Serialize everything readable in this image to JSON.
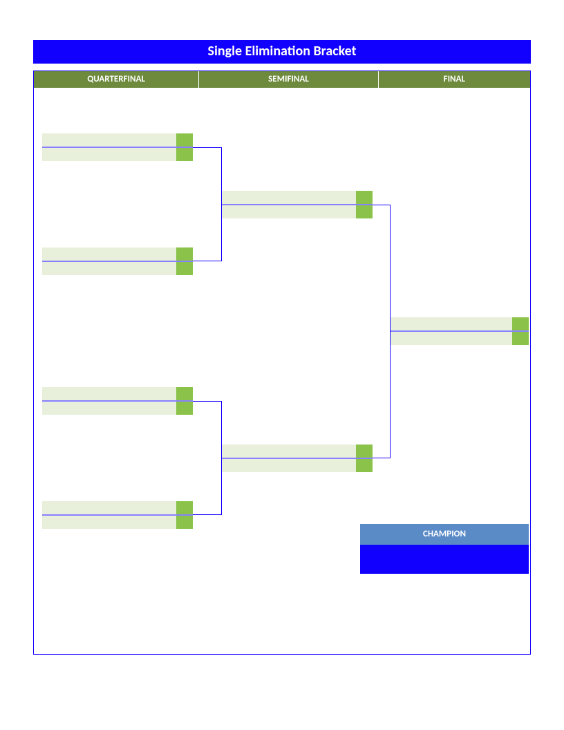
{
  "title": "Single Elimination Bracket",
  "rounds": {
    "quarterfinal": "QUARTERFINAL",
    "semifinal": "SEMIFINAL",
    "final": "FINAL"
  },
  "matches": {
    "qf1": {
      "team1": "",
      "score1": "",
      "team2": "",
      "score2": ""
    },
    "qf2": {
      "team1": "",
      "score1": "",
      "team2": "",
      "score2": ""
    },
    "qf3": {
      "team1": "",
      "score1": "",
      "team2": "",
      "score2": ""
    },
    "qf4": {
      "team1": "",
      "score1": "",
      "team2": "",
      "score2": ""
    },
    "sf1": {
      "team1": "",
      "score1": "",
      "team2": "",
      "score2": ""
    },
    "sf2": {
      "team1": "",
      "score1": "",
      "team2": "",
      "score2": ""
    },
    "final": {
      "team1": "",
      "score1": "",
      "team2": "",
      "score2": ""
    }
  },
  "champion": {
    "label": "CHAMPION",
    "name": ""
  }
}
